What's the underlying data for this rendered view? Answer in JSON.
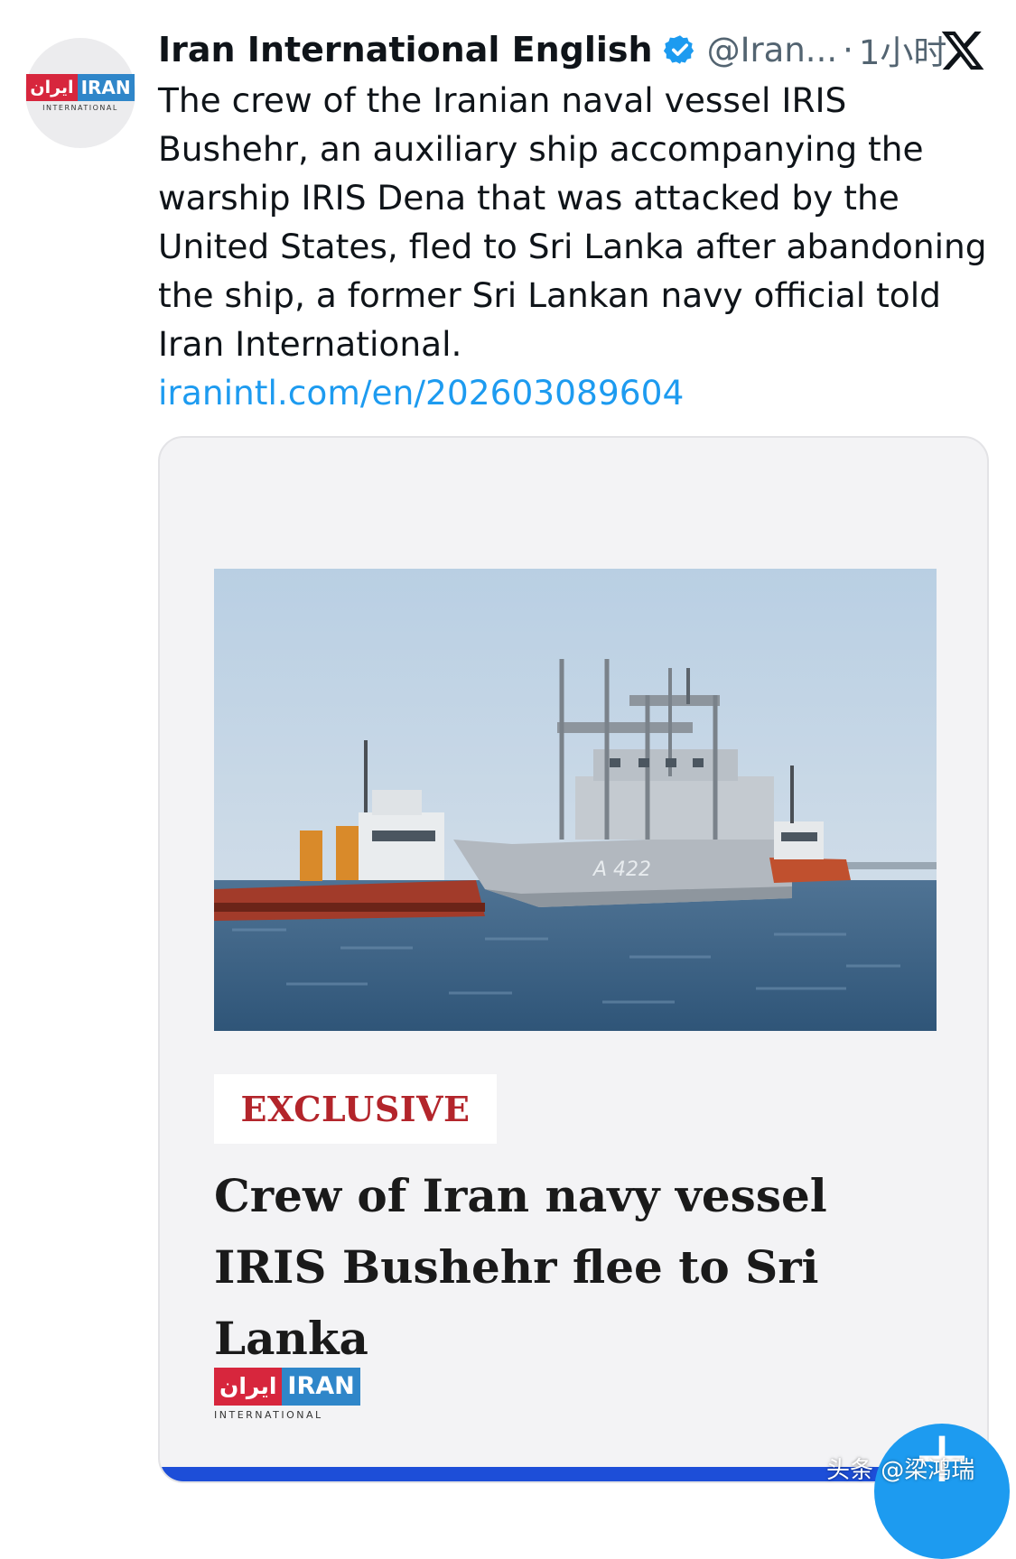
{
  "tweet": {
    "author": {
      "name": "Iran International English",
      "handle": "@Iran...",
      "separator": "·",
      "time": "1小时",
      "avatar_logo": {
        "fa": "ایران",
        "en": "IRAN",
        "sub": "INTERNATIONAL"
      }
    },
    "body": "The crew of the Iranian naval vessel IRIS Bushehr, an auxiliary ship accompanying the warship IRIS Dena that was attacked by the United States, fled to Sri Lanka after abandoning the ship, a former Sri Lankan navy official told Iran International.",
    "link": "iranintl.com/en/202603089604"
  },
  "card": {
    "photo": {
      "hull_number": "A 422"
    },
    "badge": "EXCLUSIVE",
    "headline": "Crew of Iran navy vessel IRIS Bushehr flee to Sri Lanka",
    "logo": {
      "fa": "ایران",
      "en": "IRAN",
      "sub": "INTERNATIONAL"
    },
    "progress": 0.93
  },
  "fab": {
    "icon": "plus-icon"
  },
  "watermark": "头条 @梁鸿瑞",
  "colors": {
    "link": "#1d9bf0",
    "badge": "#b3252b",
    "verified": "#1d9bf0",
    "brand_red": "#d7263d",
    "brand_blue": "#2f86c9"
  }
}
